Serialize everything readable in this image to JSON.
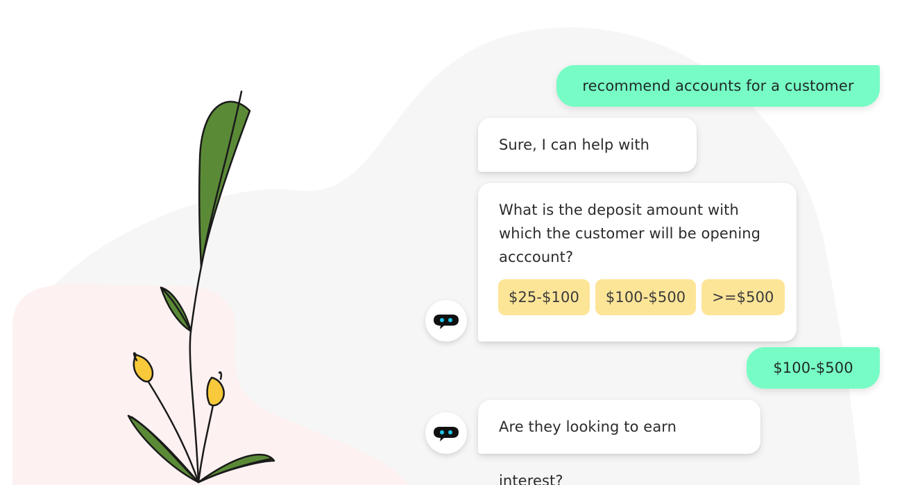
{
  "colors": {
    "user_bubble": "#77fcc5",
    "bot_bubble": "#ffffff",
    "option_chip": "#fde598",
    "bot_icon_eyes": "#1fc8e8",
    "leaf": "#5b8a37",
    "flower": "#f7c93b"
  },
  "chat": {
    "messages": [
      {
        "from": "user",
        "text": "recommend accounts for a customer"
      },
      {
        "from": "bot",
        "text": "Sure, I can help with that"
      },
      {
        "from": "bot",
        "text": "What is the deposit amount with which the customer will be opening acccount?"
      },
      {
        "from": "user",
        "text": "$100-$500"
      },
      {
        "from": "bot",
        "text": "Are they looking to earn interest?"
      }
    ],
    "options": [
      "$25-$100",
      "$100-$500",
      ">=$500"
    ],
    "avatar_icon": "chatbot-icon"
  }
}
